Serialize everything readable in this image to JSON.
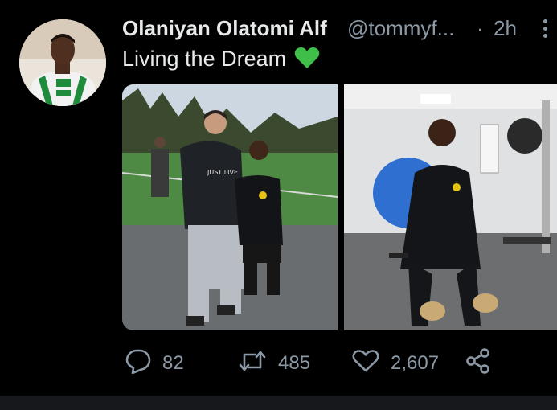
{
  "tweet": {
    "display_name": "Olaniyan Olatomi Alf",
    "handle": "@tommyf...",
    "separator": "·",
    "time": "2h",
    "text": "Living the Dream",
    "emoji_icon": "green-heart-icon",
    "more_icon": "more-vertical-icon"
  },
  "actions": {
    "reply": {
      "icon": "reply-icon",
      "count": "82"
    },
    "retweet": {
      "icon": "retweet-icon",
      "count": "485"
    },
    "like": {
      "icon": "heart-icon",
      "count": "2,607"
    },
    "share": {
      "icon": "share-icon"
    }
  },
  "colors": {
    "background": "#000000",
    "text_primary": "#e7e9ea",
    "text_secondary": "#8b98a5",
    "heart_emoji": "#3fbf4a"
  }
}
